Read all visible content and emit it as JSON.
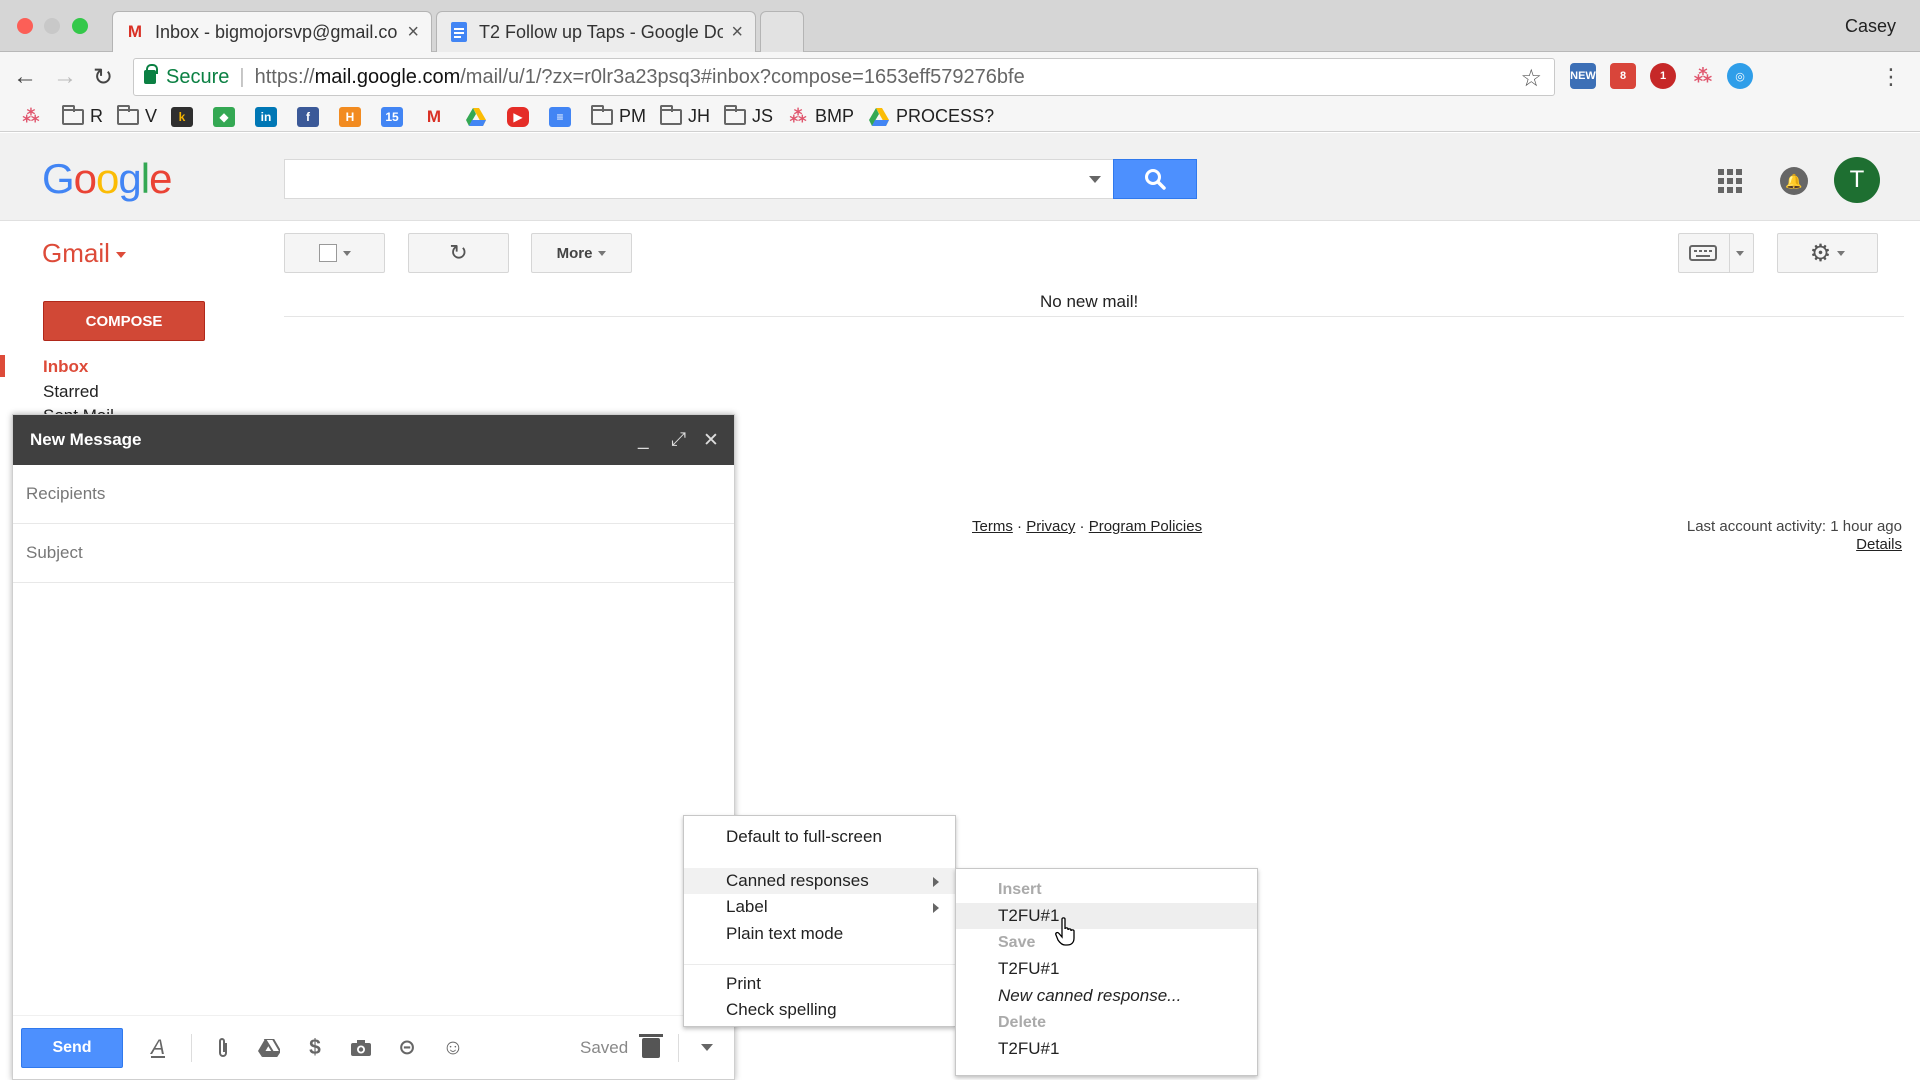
{
  "browser": {
    "tabs": [
      {
        "title": "Inbox - bigmojorsvp@gmail.co",
        "favicon": "gmail-icon",
        "active": true
      },
      {
        "title": "T2 Follow up Taps - Google Do",
        "favicon": "google-docs-icon",
        "active": false
      }
    ],
    "profile_name": "Casey",
    "omnibox": {
      "secure_label": "Secure",
      "url_scheme": "https://",
      "url_host": "mail.google.com",
      "url_path": "/mail/u/1/?zx=r0lr3a23psq3#inbox?compose=1653eff579276bfe"
    },
    "bookmarks": [
      {
        "type": "icon",
        "icon": "asana-icon"
      },
      {
        "type": "folder",
        "label": "R"
      },
      {
        "type": "folder",
        "label": "V"
      },
      {
        "type": "icon",
        "icon": "k-icon"
      },
      {
        "type": "icon",
        "icon": "maps-icon"
      },
      {
        "type": "icon",
        "icon": "linkedin-icon"
      },
      {
        "type": "icon",
        "icon": "facebook-icon"
      },
      {
        "type": "icon",
        "icon": "h-icon"
      },
      {
        "type": "icon",
        "icon": "calendar-icon"
      },
      {
        "type": "icon",
        "icon": "gmail-icon"
      },
      {
        "type": "icon",
        "icon": "drive-icon"
      },
      {
        "type": "icon",
        "icon": "youtube-icon"
      },
      {
        "type": "icon",
        "icon": "docs-icon"
      },
      {
        "type": "folder",
        "label": "PM"
      },
      {
        "type": "folder",
        "label": "JH"
      },
      {
        "type": "folder",
        "label": "JS"
      },
      {
        "type": "asana",
        "label": "BMP"
      },
      {
        "type": "drive",
        "label": "PROCESS?"
      }
    ]
  },
  "gmail": {
    "logo": [
      "G",
      "o",
      "o",
      "g",
      "l",
      "e"
    ],
    "app_label": "Gmail",
    "more_label": "More",
    "no_mail": "No new mail!",
    "compose_label": "COMPOSE",
    "nav": {
      "inbox": "Inbox",
      "starred": "Starred",
      "sent": "Sent Mail"
    },
    "avatar_letter": "T",
    "footer": {
      "terms": "Terms",
      "privacy": "Privacy",
      "policies": "Program Policies",
      "sep": " · ",
      "activity": "Last account activity: 1 hour ago",
      "details": "Details"
    }
  },
  "compose": {
    "title": "New Message",
    "recipients_placeholder": "Recipients",
    "subject_placeholder": "Subject",
    "send_label": "Send",
    "saved_label": "Saved"
  },
  "context_menu": {
    "items": [
      "Default to full-screen",
      "Canned responses",
      "Label",
      "Plain text mode",
      "Print",
      "Check spelling"
    ]
  },
  "submenu": {
    "insert_header": "Insert",
    "insert_item": "T2FU#1",
    "save_header": "Save",
    "save_item": "T2FU#1",
    "new_response": "New canned response...",
    "delete_header": "Delete",
    "delete_item": "T2FU#1"
  },
  "colors": {
    "gmail_red": "#dd4b39",
    "compose_red": "#d14836",
    "primary_blue": "#4d90fe",
    "header_dark": "#404040"
  }
}
